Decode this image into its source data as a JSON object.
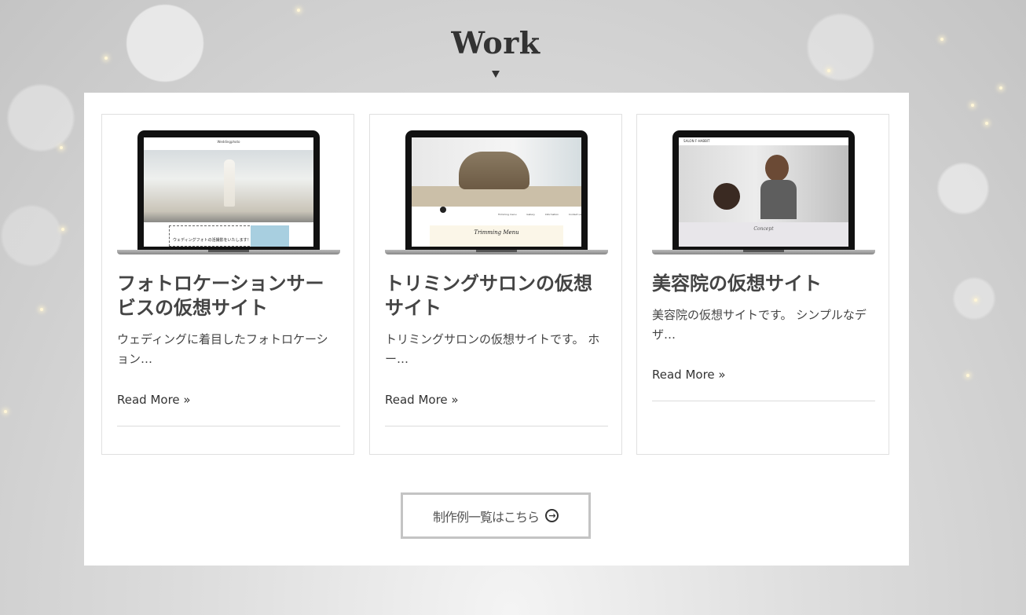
{
  "section": {
    "title": "Work"
  },
  "works": [
    {
      "title": "フォトロケーションサービスの仮想サイト",
      "excerpt": "ウェディングに着目したフォトロケーション…",
      "read_more": "Read More »",
      "screen": {
        "site_name": "Weddingphoto",
        "banner": "ウェディングフォトの活撮影をいたします！"
      }
    },
    {
      "title": "トリミングサロンの仮想サイト",
      "excerpt": "トリミングサロンの仮想サイトです。 ホー…",
      "read_more": "Read More »",
      "screen": {
        "nav": [
          "Trimming menu",
          "Gallery",
          "Information",
          "Contact us"
        ],
        "heading": "Trimming Menu"
      }
    },
    {
      "title": "美容院の仮想サイト",
      "excerpt": "美容院の仮想サイトです。 シンプルなデザ…",
      "read_more": "Read More »",
      "screen": {
        "site_name": "SALON F-HABBIT",
        "sub": "Concept"
      }
    }
  ],
  "list_button": {
    "label": "制作例一覧はこちら",
    "icon": "circle-arrow-right-icon"
  },
  "colors": {
    "panel": "#ffffff",
    "text": "#444444",
    "button_border": "#c4c4c4"
  }
}
